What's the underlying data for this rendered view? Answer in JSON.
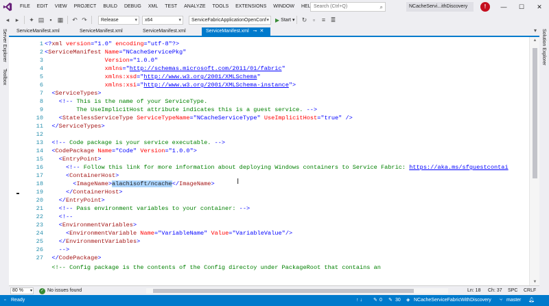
{
  "menubar": {
    "items": [
      "FILE",
      "EDIT",
      "VIEW",
      "PROJECT",
      "BUILD",
      "DEBUG",
      "XML",
      "TEST",
      "ANALYZE",
      "TOOLS",
      "EXTENSIONS",
      "WINDOW",
      "HELP"
    ],
    "quick_launch_placeholder": "Search (Ctrl+Q)",
    "solution_name": "NCacheServi...ithDiscovery",
    "avatar_initial": "!"
  },
  "toolbar": {
    "configuration": "Release",
    "platform": "x64",
    "startup_project": "ServiceFabricApplicationOpenConf",
    "start_label": "Start"
  },
  "side_panels": {
    "left": [
      "Server Explorer",
      "Toolbox"
    ],
    "right": [
      "Solution Explorer"
    ]
  },
  "tabs": [
    {
      "label": "ServiceManifest.xml",
      "active": false
    },
    {
      "label": "ServiceManifest.xml",
      "active": false
    },
    {
      "label": "ServiceManifest.xml",
      "active": false
    },
    {
      "label": "ServiceManifest.xml",
      "active": true
    }
  ],
  "editor": {
    "line_numbers": [
      "1",
      "2",
      "3",
      "4",
      "5",
      "6",
      "7",
      "8",
      "9",
      "10",
      "11",
      "12",
      "13",
      "14",
      "15",
      "16",
      "17",
      "18",
      "19",
      "20",
      "21",
      "22",
      "23",
      "24",
      "25",
      "26",
      "27"
    ],
    "lines": [
      [
        [
          "br",
          "<?"
        ],
        [
          "tag",
          "xml"
        ],
        [
          "txt",
          " "
        ],
        [
          "attr",
          "version"
        ],
        [
          "br",
          "=\""
        ],
        [
          "val",
          "1.0"
        ],
        [
          "br",
          "\""
        ],
        [
          "txt",
          " "
        ],
        [
          "attr",
          "encoding"
        ],
        [
          "br",
          "=\""
        ],
        [
          "val",
          "utf-8"
        ],
        [
          "br",
          "\"?>"
        ]
      ],
      [
        [
          "br",
          "<"
        ],
        [
          "tag",
          "ServiceManifest"
        ],
        [
          "txt",
          " "
        ],
        [
          "attr",
          "Name"
        ],
        [
          "br",
          "=\""
        ],
        [
          "val",
          "NCacheServicePkg"
        ],
        [
          "br",
          "\""
        ]
      ],
      [
        [
          "txt",
          "                 "
        ],
        [
          "attr",
          "Version"
        ],
        [
          "br",
          "=\""
        ],
        [
          "val",
          "1.0.0"
        ],
        [
          "br",
          "\""
        ]
      ],
      [
        [
          "txt",
          "                 "
        ],
        [
          "attr",
          "xmlns"
        ],
        [
          "br",
          "=\""
        ],
        [
          "link",
          "http://schemas.microsoft.com/2011/01/fabric"
        ],
        [
          "br",
          "\""
        ]
      ],
      [
        [
          "txt",
          "                 "
        ],
        [
          "attr",
          "xmlns:xsd"
        ],
        [
          "br",
          "=\""
        ],
        [
          "link",
          "http://www.w3.org/2001/XMLSchema"
        ],
        [
          "br",
          "\""
        ]
      ],
      [
        [
          "txt",
          "                 "
        ],
        [
          "attr",
          "xmlns:xsi"
        ],
        [
          "br",
          "=\""
        ],
        [
          "link",
          "http://www.w3.org/2001/XMLSchema-instance"
        ],
        [
          "br",
          "\">"
        ]
      ],
      [
        [
          "txt",
          "  "
        ],
        [
          "br",
          "<"
        ],
        [
          "tag",
          "ServiceTypes"
        ],
        [
          "br",
          ">"
        ]
      ],
      [
        [
          "txt",
          "    "
        ],
        [
          "br",
          "<!--"
        ],
        [
          "com",
          " This is the name of your ServiceType.",
          ""
        ]
      ],
      [
        [
          "com",
          "         The UseImplicitHost attribute indicates this is a guest service. "
        ],
        [
          "br",
          "-->"
        ]
      ],
      [
        [
          "txt",
          "    "
        ],
        [
          "br",
          "<"
        ],
        [
          "tag",
          "StatelessServiceType"
        ],
        [
          "txt",
          " "
        ],
        [
          "attr",
          "ServiceTypeName"
        ],
        [
          "br",
          "=\""
        ],
        [
          "val",
          "NCacheServiceType"
        ],
        [
          "br",
          "\""
        ],
        [
          "txt",
          " "
        ],
        [
          "attr",
          "UseImplicitHost"
        ],
        [
          "br",
          "=\""
        ],
        [
          "val",
          "true"
        ],
        [
          "br",
          "\""
        ],
        [
          "txt",
          " "
        ],
        [
          "br",
          "/>"
        ]
      ],
      [
        [
          "txt",
          "  "
        ],
        [
          "br",
          "</"
        ],
        [
          "tag",
          "ServiceTypes"
        ],
        [
          "br",
          ">"
        ]
      ],
      [],
      [
        [
          "txt",
          "  "
        ],
        [
          "br",
          "<!--"
        ],
        [
          "com",
          " Code package is your service executable. "
        ],
        [
          "br",
          "-->"
        ]
      ],
      [
        [
          "txt",
          "  "
        ],
        [
          "br",
          "<"
        ],
        [
          "tag",
          "CodePackage"
        ],
        [
          "txt",
          " "
        ],
        [
          "attr",
          "Name"
        ],
        [
          "br",
          "=\""
        ],
        [
          "val",
          "Code"
        ],
        [
          "br",
          "\""
        ],
        [
          "txt",
          " "
        ],
        [
          "attr",
          "Version"
        ],
        [
          "br",
          "=\""
        ],
        [
          "val",
          "1.0.0"
        ],
        [
          "br",
          "\">"
        ]
      ],
      [
        [
          "txt",
          "    "
        ],
        [
          "br",
          "<"
        ],
        [
          "tag",
          "EntryPoint"
        ],
        [
          "br",
          ">"
        ]
      ],
      [
        [
          "txt",
          "      "
        ],
        [
          "br",
          "<!--"
        ],
        [
          "com",
          " Follow this link for more information about deploying Windows containers to Service Fabric: "
        ],
        [
          "link",
          "https://aka.ms/sfguestcontai"
        ]
      ],
      [
        [
          "txt",
          "      "
        ],
        [
          "br",
          "<"
        ],
        [
          "tag",
          "ContainerHost"
        ],
        [
          "br",
          ">"
        ]
      ],
      [
        [
          "txt",
          "        "
        ],
        [
          "br",
          "<"
        ],
        [
          "tag",
          "ImageName"
        ],
        [
          "br",
          ">"
        ],
        [
          "sel",
          "alachisoft/ncache"
        ],
        [
          "br",
          "</"
        ],
        [
          "tag",
          "ImageName"
        ],
        [
          "br",
          ">"
        ]
      ],
      [
        [
          "txt",
          "      "
        ],
        [
          "br",
          "</"
        ],
        [
          "tag",
          "ContainerHost"
        ],
        [
          "br",
          ">"
        ]
      ],
      [
        [
          "txt",
          "    "
        ],
        [
          "br",
          "</"
        ],
        [
          "tag",
          "EntryPoint"
        ],
        [
          "br",
          ">"
        ]
      ],
      [
        [
          "txt",
          "    "
        ],
        [
          "br",
          "<!--"
        ],
        [
          "com",
          " Pass environment variables to your container: "
        ],
        [
          "br",
          "-->"
        ]
      ],
      [
        [
          "txt",
          "    "
        ],
        [
          "br",
          "<!--"
        ]
      ],
      [
        [
          "txt",
          "    "
        ],
        [
          "br",
          "<"
        ],
        [
          "tag",
          "EnvironmentVariables"
        ],
        [
          "br",
          ">"
        ]
      ],
      [
        [
          "txt",
          "      "
        ],
        [
          "br",
          "<"
        ],
        [
          "tag",
          "EnvironmentVariable"
        ],
        [
          "txt",
          " "
        ],
        [
          "attr",
          "Name"
        ],
        [
          "br",
          "=\""
        ],
        [
          "val",
          "VariableName"
        ],
        [
          "br",
          "\""
        ],
        [
          "txt",
          " "
        ],
        [
          "attr",
          "Value"
        ],
        [
          "br",
          "=\""
        ],
        [
          "val",
          "VariableValue"
        ],
        [
          "br",
          "\"/>"
        ]
      ],
      [
        [
          "txt",
          "    "
        ],
        [
          "br",
          "</"
        ],
        [
          "tag",
          "EnvironmentVariables"
        ],
        [
          "br",
          ">"
        ]
      ],
      [
        [
          "txt",
          "    "
        ],
        [
          "br",
          "-->"
        ]
      ],
      [
        [
          "txt",
          "  "
        ],
        [
          "br",
          "</"
        ],
        [
          "tag",
          "CodePackage"
        ],
        [
          "br",
          ">"
        ]
      ]
    ],
    "partial_line_text": "  <!-- Config package is the contents of the Config directoy under PackageRoot that contains an"
  },
  "editor_status": {
    "zoom": "80 %",
    "issues": "No issues found",
    "ln": "Ln: 18",
    "ch": "Ch: 37",
    "mode": "SPC",
    "eol": "CRLF"
  },
  "statusbar": {
    "ready": "Ready",
    "arrows": "↑ ↓",
    "errors_count": "0",
    "changes_count": "30",
    "solution": "NCacheServiceFabricWithDiscovery",
    "branch": "master"
  },
  "colors": {
    "accent": "#007acc",
    "tag": "#a31515",
    "attribute": "#ff0000",
    "value": "#0000ff",
    "comment": "#008000",
    "line_number": "#2b91af",
    "selection": "#add6ff"
  }
}
